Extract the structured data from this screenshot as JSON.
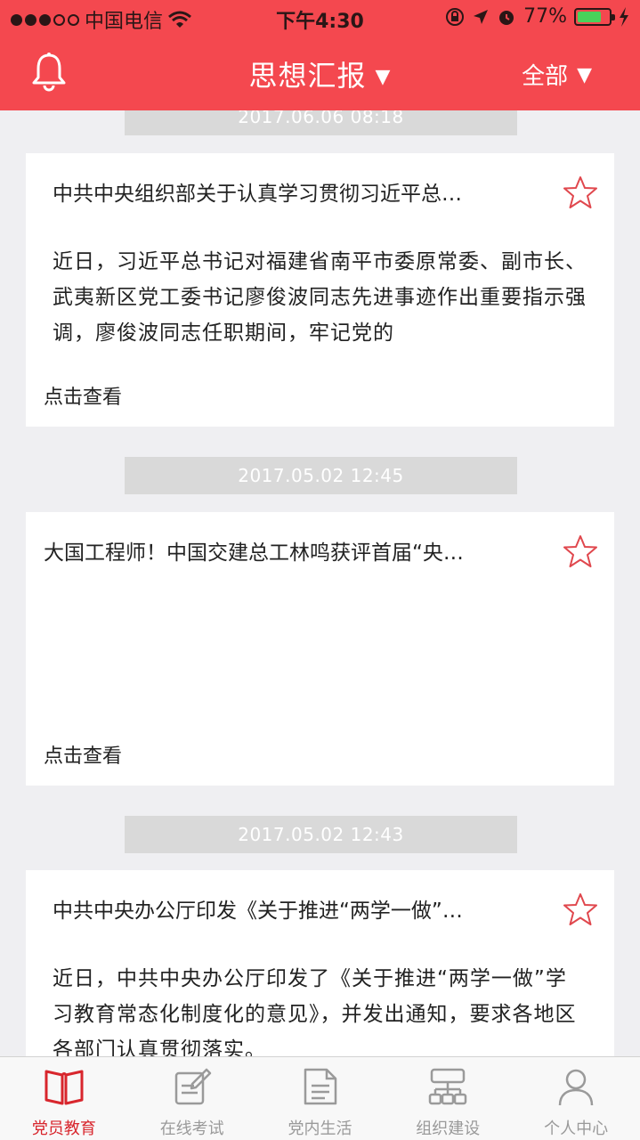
{
  "status_bar": {
    "carrier": "中国电信",
    "time": "下午4:30",
    "battery_percent": "77%",
    "battery_level": 0.77,
    "signal_bars_filled": 3,
    "signal_bars_total": 5
  },
  "nav": {
    "title": "思想汇报",
    "title_caret": "▼",
    "filter": "全部",
    "filter_caret": "▼",
    "accent_color": "#f4484f"
  },
  "feed": [
    {
      "date": "2017.06.06  08:18",
      "title": "中共中央组织部关于认真学习贯彻习近平总…",
      "body": "近日，习近平总书记对福建省南平市委原常委、副市长、武夷新区党工委书记廖俊波同志先进事迹作出重要指示强调，廖俊波同志任职期间，牢记党的",
      "link": "点击查看"
    },
    {
      "date": "2017.05.02  12:45",
      "title": "大国工程师！中国交建总工林鸣获评首届“央…",
      "body": "",
      "link": "点击查看"
    },
    {
      "date": "2017.05.02  12:43",
      "title": "中共中央办公厅印发《关于推进“两学一做”…",
      "body": "近日，中共中央办公厅印发了《关于推进“两学一做”学习教育常态化制度化的意见》，并发出通知，要求各地区各部门认真贯彻落实。",
      "link": ""
    }
  ],
  "tabs": [
    {
      "label": "党员教育",
      "icon": "book-icon",
      "active": true
    },
    {
      "label": "在线考试",
      "icon": "edit-note-icon",
      "active": false
    },
    {
      "label": "党内生活",
      "icon": "document-icon",
      "active": false
    },
    {
      "label": "组织建设",
      "icon": "org-chart-icon",
      "active": false
    },
    {
      "label": "个人中心",
      "icon": "person-icon",
      "active": false
    }
  ]
}
